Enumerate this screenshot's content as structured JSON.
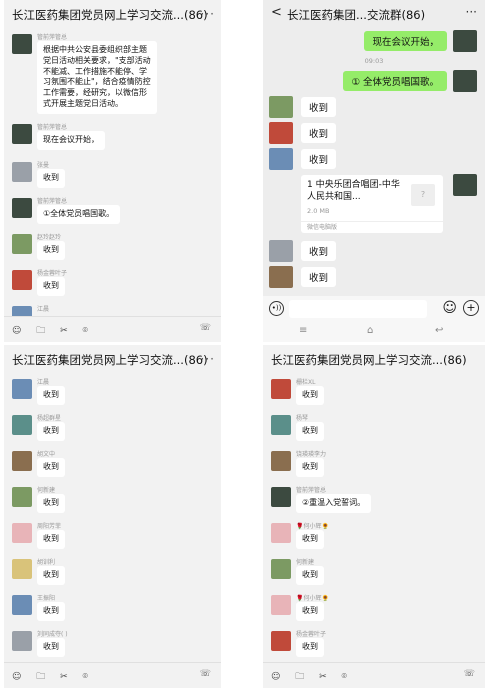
{
  "panel1": {
    "title": "长江医药集团党员网上学习交流...(86)",
    "more": "···",
    "messages": [
      {
        "sender": "管前萍管总",
        "text": "根据中共公安县委组织部主题党日活动相关要求，\"支部活动不能减、工作措施不能停、学习氛围不能止\"，结合疫情防控工作需要，经研究，以微信形式开展主题党日活动。"
      },
      {
        "sender": "管前萍管总",
        "text": "现在会议开始，"
      },
      {
        "sender": "张曼",
        "text": "收到"
      },
      {
        "sender": "管前萍管总",
        "text": "①全体党员唱国歌。"
      },
      {
        "sender": "赵玲赵玲",
        "text": "收到"
      },
      {
        "sender": "杨金蓉叶子",
        "text": "收到"
      },
      {
        "sender": "江晨",
        "text": ""
      }
    ],
    "toolbar": "☺ 🗀 ✂ ⌾",
    "call_icon": "☏"
  },
  "panel2": {
    "back": "<",
    "title": "长江医药集团...交流群(86)",
    "more": "···",
    "sent1": "现在会议开始，",
    "time": "09:03",
    "sent2": "① 全体党员唱国歌。",
    "received": [
      "收到",
      "收到",
      "收到"
    ],
    "file_name": "1 中央乐团合唱团-中华人民共和国...",
    "file_size": "2.0 MB",
    "file_source": "微信电脑版",
    "file_icon": "?",
    "received_after": [
      "收到",
      "收到"
    ],
    "voice": "•))",
    "emoji": "☺",
    "plus": "+",
    "nav": [
      "≡",
      "⌂",
      "↩"
    ]
  },
  "panel3": {
    "title": "长江医药集团党员网上学习交流...(86)",
    "more": "···",
    "messages": [
      {
        "sender": "江晨",
        "text": "收到"
      },
      {
        "sender": "杨超群星",
        "text": "收到"
      },
      {
        "sender": "胡文中",
        "text": "收到"
      },
      {
        "sender": "何新建",
        "text": "收到"
      },
      {
        "sender": "周阳芳菲",
        "text": "收到"
      },
      {
        "sender": "胡训利",
        "text": "收到"
      },
      {
        "sender": "王振阳",
        "text": "收到"
      },
      {
        "sender": "刘同成夺( )",
        "text": "收到"
      }
    ],
    "toolbar": "☺ 🗀 ✂ ⌾",
    "call_icon": "☏"
  },
  "panel4": {
    "title": "长江医药集团党员网上学习交流...(86)",
    "messages": [
      {
        "sender": "栅栏XL",
        "text": "收到"
      },
      {
        "sender": "杨琴",
        "text": "收到"
      },
      {
        "sender": "饶瑛瑛李力",
        "text": "收到"
      },
      {
        "sender": "管前萍管总",
        "text": "②重温入党誓词。"
      },
      {
        "sender": "🌹何小辉🌻",
        "text": "收到"
      },
      {
        "sender": "何新建",
        "text": "收到"
      },
      {
        "sender": "🌹何小辉🌻",
        "text": "收到"
      },
      {
        "sender": "杨金蓉叶子",
        "text": "收到"
      }
    ],
    "toolbar": "☺ 🗀 ✂ ⌾",
    "call_icon": "☏"
  }
}
